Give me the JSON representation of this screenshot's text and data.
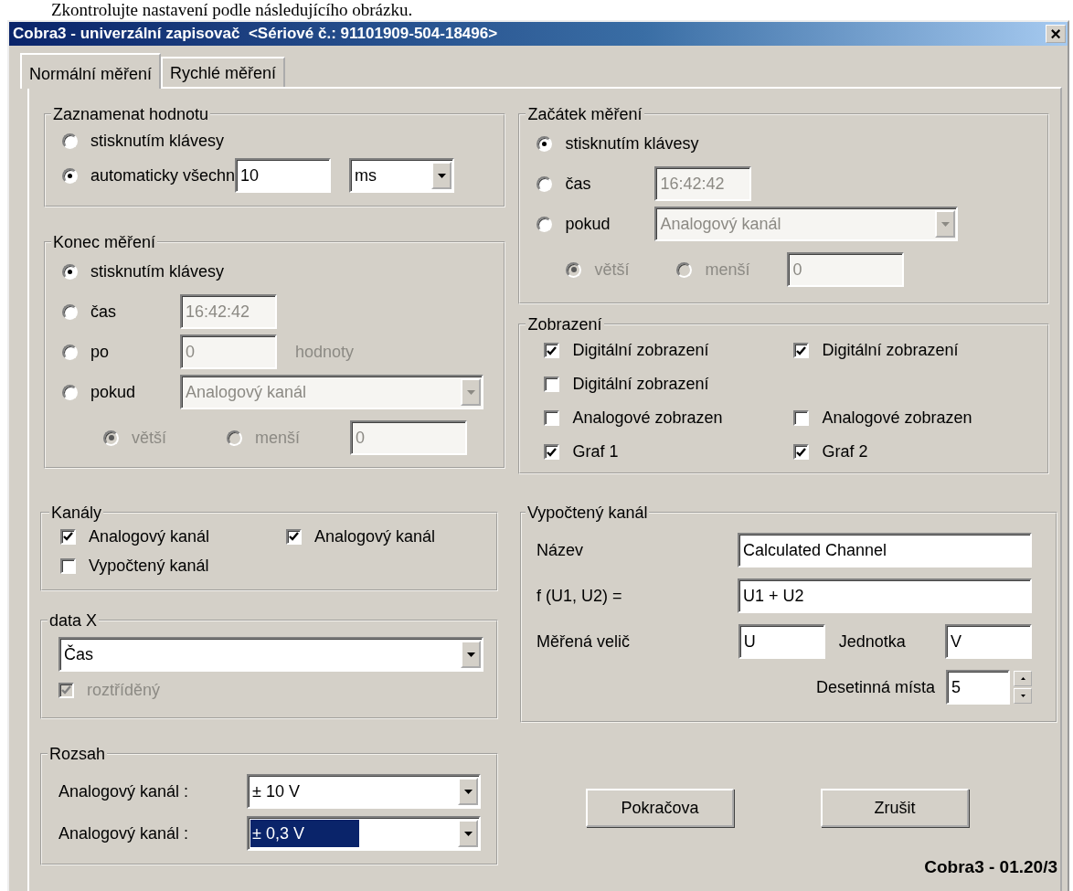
{
  "caption": "Zkontrolujte nastavení podle následujícího obrázku.",
  "window": {
    "title": "Cobra3 - univerzální zapisovač  <Sériové č.: 91101909-504-18496>",
    "close": "×"
  },
  "tabs": [
    {
      "label": "Normální měření",
      "selected": true
    },
    {
      "label": "Rychlé měření",
      "selected": false
    }
  ],
  "record_value": {
    "title": "Zaznamenat hodnotu",
    "options": [
      {
        "label": "stisknutím klávesy",
        "selected": false
      },
      {
        "label": "automaticky všechn",
        "selected": true,
        "field": {
          "value": "10"
        },
        "unit": {
          "kind": "select",
          "value": "ms"
        }
      }
    ]
  },
  "start": {
    "title": "Začátek měření",
    "options": [
      {
        "label": "stisknutím klávesy",
        "selected": true
      },
      {
        "label": "čas",
        "selected": false,
        "field": {
          "kind": "text",
          "value": "16:42:42",
          "disabled": true
        }
      },
      {
        "label": "pokud",
        "selected": false,
        "field": {
          "kind": "select",
          "value": "Analogový kanál",
          "disabled": true
        }
      }
    ],
    "comparison": [
      {
        "label": "větší",
        "selected": true,
        "disabled": true
      },
      {
        "label": "menší",
        "selected": false,
        "disabled": true
      }
    ],
    "threshold": {
      "value": "0",
      "disabled": true
    }
  },
  "end": {
    "title": "Konec měření",
    "options": [
      {
        "label": "stisknutím klávesy",
        "selected": true
      },
      {
        "label": "čas",
        "selected": false,
        "field": {
          "kind": "text",
          "value": "16:42:42",
          "disabled": true
        }
      },
      {
        "label": "po",
        "selected": false,
        "field": {
          "kind": "text",
          "value": "0",
          "disabled": true
        },
        "suffix": "hodnoty"
      },
      {
        "label": "pokud",
        "selected": false,
        "field": {
          "kind": "select",
          "value": "Analogový kanál",
          "disabled": true
        }
      }
    ],
    "comparison": [
      {
        "label": "větší",
        "selected": true,
        "disabled": true
      },
      {
        "label": "menší",
        "selected": false,
        "disabled": true
      }
    ],
    "threshold": {
      "value": "0",
      "disabled": true
    }
  },
  "display": {
    "title": "Zobrazení",
    "rows": [
      {
        "items": [
          {
            "label": "Digitální zobrazení",
            "checked": true
          },
          {
            "label": "Digitální zobrazení",
            "checked": true
          }
        ]
      },
      {
        "items": [
          {
            "label": "Digitální zobrazení",
            "checked": false
          }
        ]
      },
      {
        "items": [
          {
            "label": "Analogové zobrazen",
            "checked": false
          },
          {
            "label": "Analogové zobrazen",
            "checked": false
          }
        ]
      },
      {
        "items": [
          {
            "label": "Graf 1",
            "checked": true
          },
          {
            "label": "Graf 2",
            "checked": true
          }
        ]
      }
    ]
  },
  "channels": {
    "title": "Kanály",
    "rows": [
      {
        "items": [
          {
            "label": "Analogový kanál",
            "checked": true
          },
          {
            "label": "Analogový kanál",
            "checked": true
          }
        ]
      },
      {
        "items": [
          {
            "label": "Vypočtený kanál",
            "checked": false
          }
        ]
      }
    ]
  },
  "data_x": {
    "title": "data X",
    "value": "Čas",
    "sorted": {
      "label": "roztříděný",
      "checked": true,
      "disabled": true
    }
  },
  "range": {
    "title": "Rozsah",
    "rows": [
      {
        "label": "Analogový kanál :",
        "value": "± 10 V",
        "selected": false
      },
      {
        "label": "Analogový kanál :",
        "value": "± 0,3 V",
        "selected": true
      }
    ]
  },
  "calculated": {
    "title": "Vypočtený kanál",
    "name_label": "Název",
    "name": "Calculated Channel",
    "formula_label": "f (U1, U2) =",
    "formula": "U1 + U2",
    "quantity_label": "Měřená velič",
    "quantity": "U",
    "unit_label": "Jednotka",
    "unit": "V",
    "decimals_label": "Desetinná místa",
    "decimals": "5"
  },
  "buttons": [
    "Pokračova",
    "Zrušit"
  ],
  "version": "Cobra3 - 01.20/3"
}
